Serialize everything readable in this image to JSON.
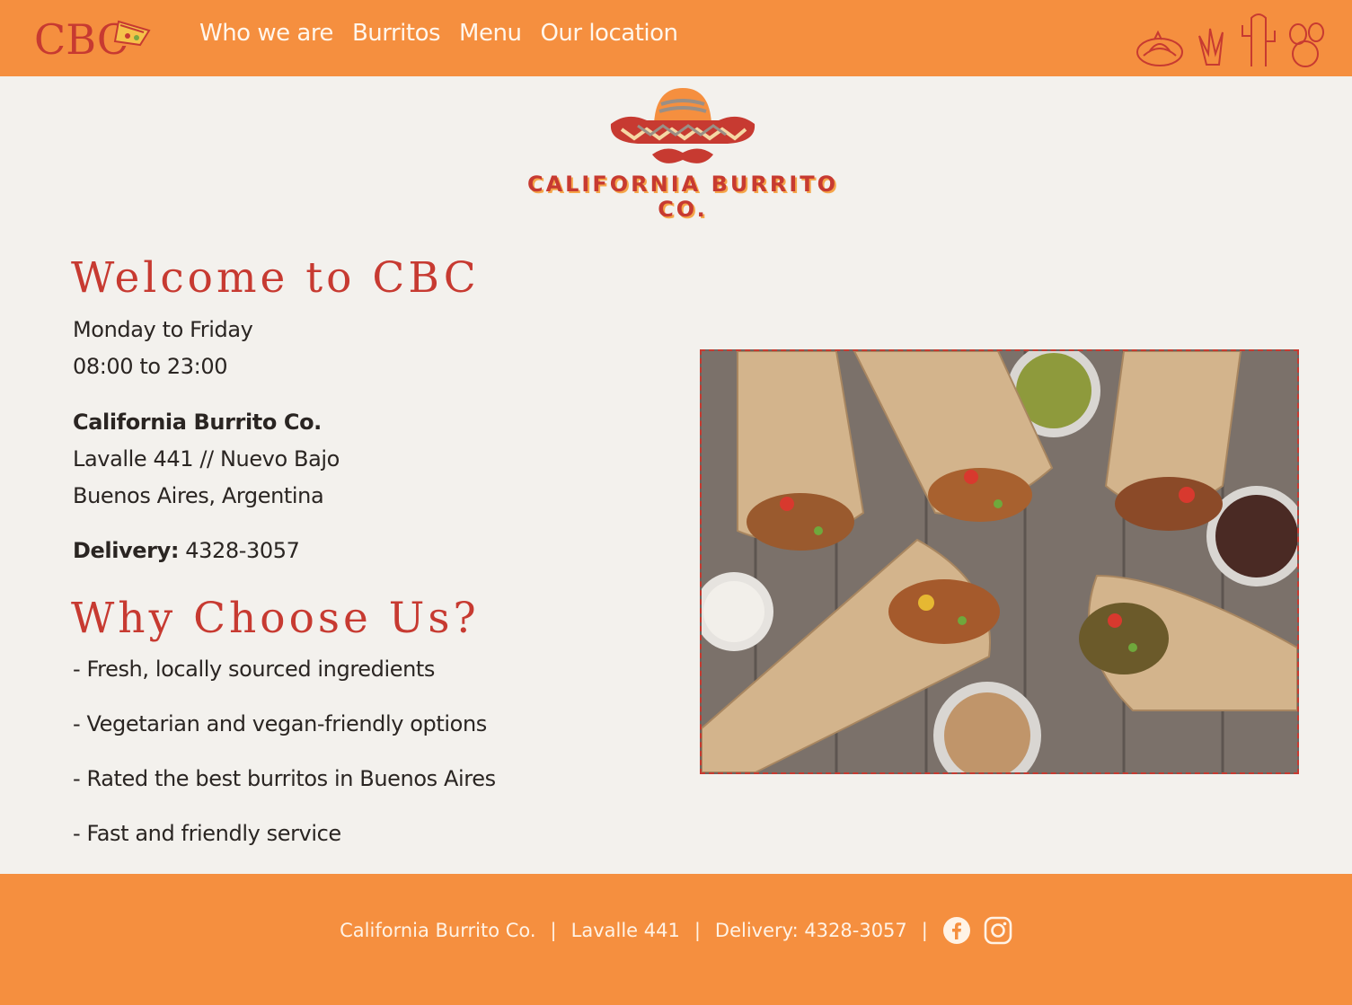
{
  "header": {
    "logo_text": "CBC",
    "nav": [
      {
        "label": "Who we are"
      },
      {
        "label": "Burritos"
      },
      {
        "label": "Menu"
      },
      {
        "label": "Our location"
      }
    ]
  },
  "brand": {
    "name": "CALIFORNIA BURRITO CO."
  },
  "welcome": {
    "title": "Welcome to CBC",
    "hours_days": "Monday to Friday",
    "hours_time": "08:00 to 23:00",
    "company": "California Burrito Co.",
    "address_line1": "Lavalle 441 // Nuevo Bajo",
    "address_line2": "Buenos Aires, Argentina",
    "delivery_label": "Delivery:",
    "delivery_phone": "4328-3057"
  },
  "why": {
    "title": "Why Choose Us?",
    "items": [
      "- Fresh, locally sourced ingredients",
      "- Vegetarian and vegan-friendly options",
      "- Rated the best burritos in Buenos Aires",
      "- Fast and friendly service"
    ]
  },
  "footer": {
    "company": "California Burrito Co.",
    "separator": "|",
    "address": "Lavalle 441",
    "delivery": "Delivery: 4328-3057",
    "social_icons": [
      "facebook-icon",
      "instagram-icon"
    ]
  },
  "colors": {
    "header_bg": "#f58f3f",
    "accent_red": "#c73a31",
    "page_bg": "#f3f1ed",
    "nav_text": "#fff6ec"
  }
}
